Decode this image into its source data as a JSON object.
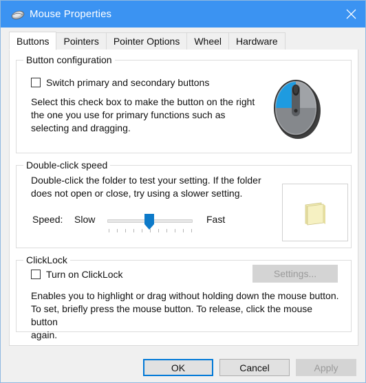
{
  "window": {
    "title": "Mouse Properties",
    "icon": "mouse-icon",
    "close_label": "Close",
    "titlebar_color": "#3b93f2"
  },
  "tabs": [
    {
      "label": "Buttons",
      "selected": true
    },
    {
      "label": "Pointers",
      "selected": false
    },
    {
      "label": "Pointer Options",
      "selected": false
    },
    {
      "label": "Wheel",
      "selected": false
    },
    {
      "label": "Hardware",
      "selected": false
    }
  ],
  "button_configuration": {
    "group_title": "Button configuration",
    "switch_buttons": {
      "label": "Switch primary and secondary buttons",
      "checked": false
    },
    "description": "Select this check box to make the button on the right\nthe one you use for primary functions such as\nselecting and dragging.",
    "preview_icon": "mouse-preview-icon",
    "preview_highlight_color": "#1e9be0"
  },
  "double_click_speed": {
    "group_title": "Double-click speed",
    "description": "Double-click the folder to test your setting. If the folder\ndoes not open or close, try using a slower setting.",
    "speed_label": "Speed:",
    "slow_label": "Slow",
    "fast_label": "Fast",
    "slider_value": 50,
    "slider_min": 0,
    "slider_max": 100,
    "slider_tick_count": 11,
    "accent_color": "#0d7ac9",
    "test_area_icon": "folder-icon"
  },
  "clicklock": {
    "group_title": "ClickLock",
    "turn_on": {
      "label": "Turn on ClickLock",
      "checked": false
    },
    "settings_button": {
      "label": "Settings...",
      "enabled": false
    },
    "description": "Enables you to highlight or drag without holding down the mouse button.\nTo set, briefly press the mouse button. To release, click the mouse button\nagain."
  },
  "footer": {
    "ok": {
      "label": "OK",
      "default": true,
      "enabled": true
    },
    "cancel": {
      "label": "Cancel",
      "enabled": true
    },
    "apply": {
      "label": "Apply",
      "enabled": false
    }
  }
}
